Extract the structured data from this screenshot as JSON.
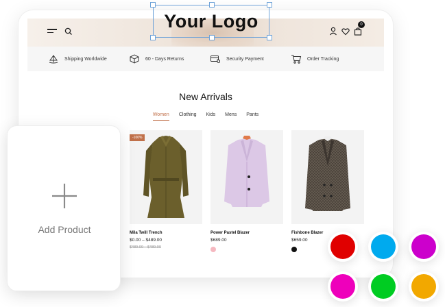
{
  "logo": {
    "text": "Your Logo"
  },
  "header": {
    "cart_count": "0"
  },
  "features": [
    {
      "icon": "ship-icon",
      "label": "Shipping Worldwide"
    },
    {
      "icon": "returns-box-icon",
      "label": "60 - Days Returns"
    },
    {
      "icon": "secure-card-icon",
      "label": "Security Payment"
    },
    {
      "icon": "cart-tracking-icon",
      "label": "Order Tracking"
    }
  ],
  "section": {
    "title": "New Arrivals"
  },
  "tabs": [
    {
      "label": "Women",
      "active": true
    },
    {
      "label": "Clothing",
      "active": false
    },
    {
      "label": "Kids",
      "active": false
    },
    {
      "label": "Mens",
      "active": false
    },
    {
      "label": "Pants",
      "active": false
    }
  ],
  "products": [
    {
      "name": "Mila Twill Trench",
      "price": "$0.00 – $489.00",
      "old_price": "$489.00 – $489.00",
      "badge": "-100%",
      "swatch": ""
    },
    {
      "name": "Power Pastel Blazer",
      "price": "$689.00",
      "old_price": "",
      "badge": "",
      "swatch": "#f5b8c0"
    },
    {
      "name": "Fishbone Blazer",
      "price": "$659.00",
      "old_price": "",
      "badge": "",
      "swatch": "#111111"
    }
  ],
  "add_product": {
    "label": "Add Product"
  },
  "colors": [
    "#e00000",
    "#00aaee",
    "#cc00cc",
    "#ee00bb",
    "#00cc22",
    "#f2a800"
  ]
}
